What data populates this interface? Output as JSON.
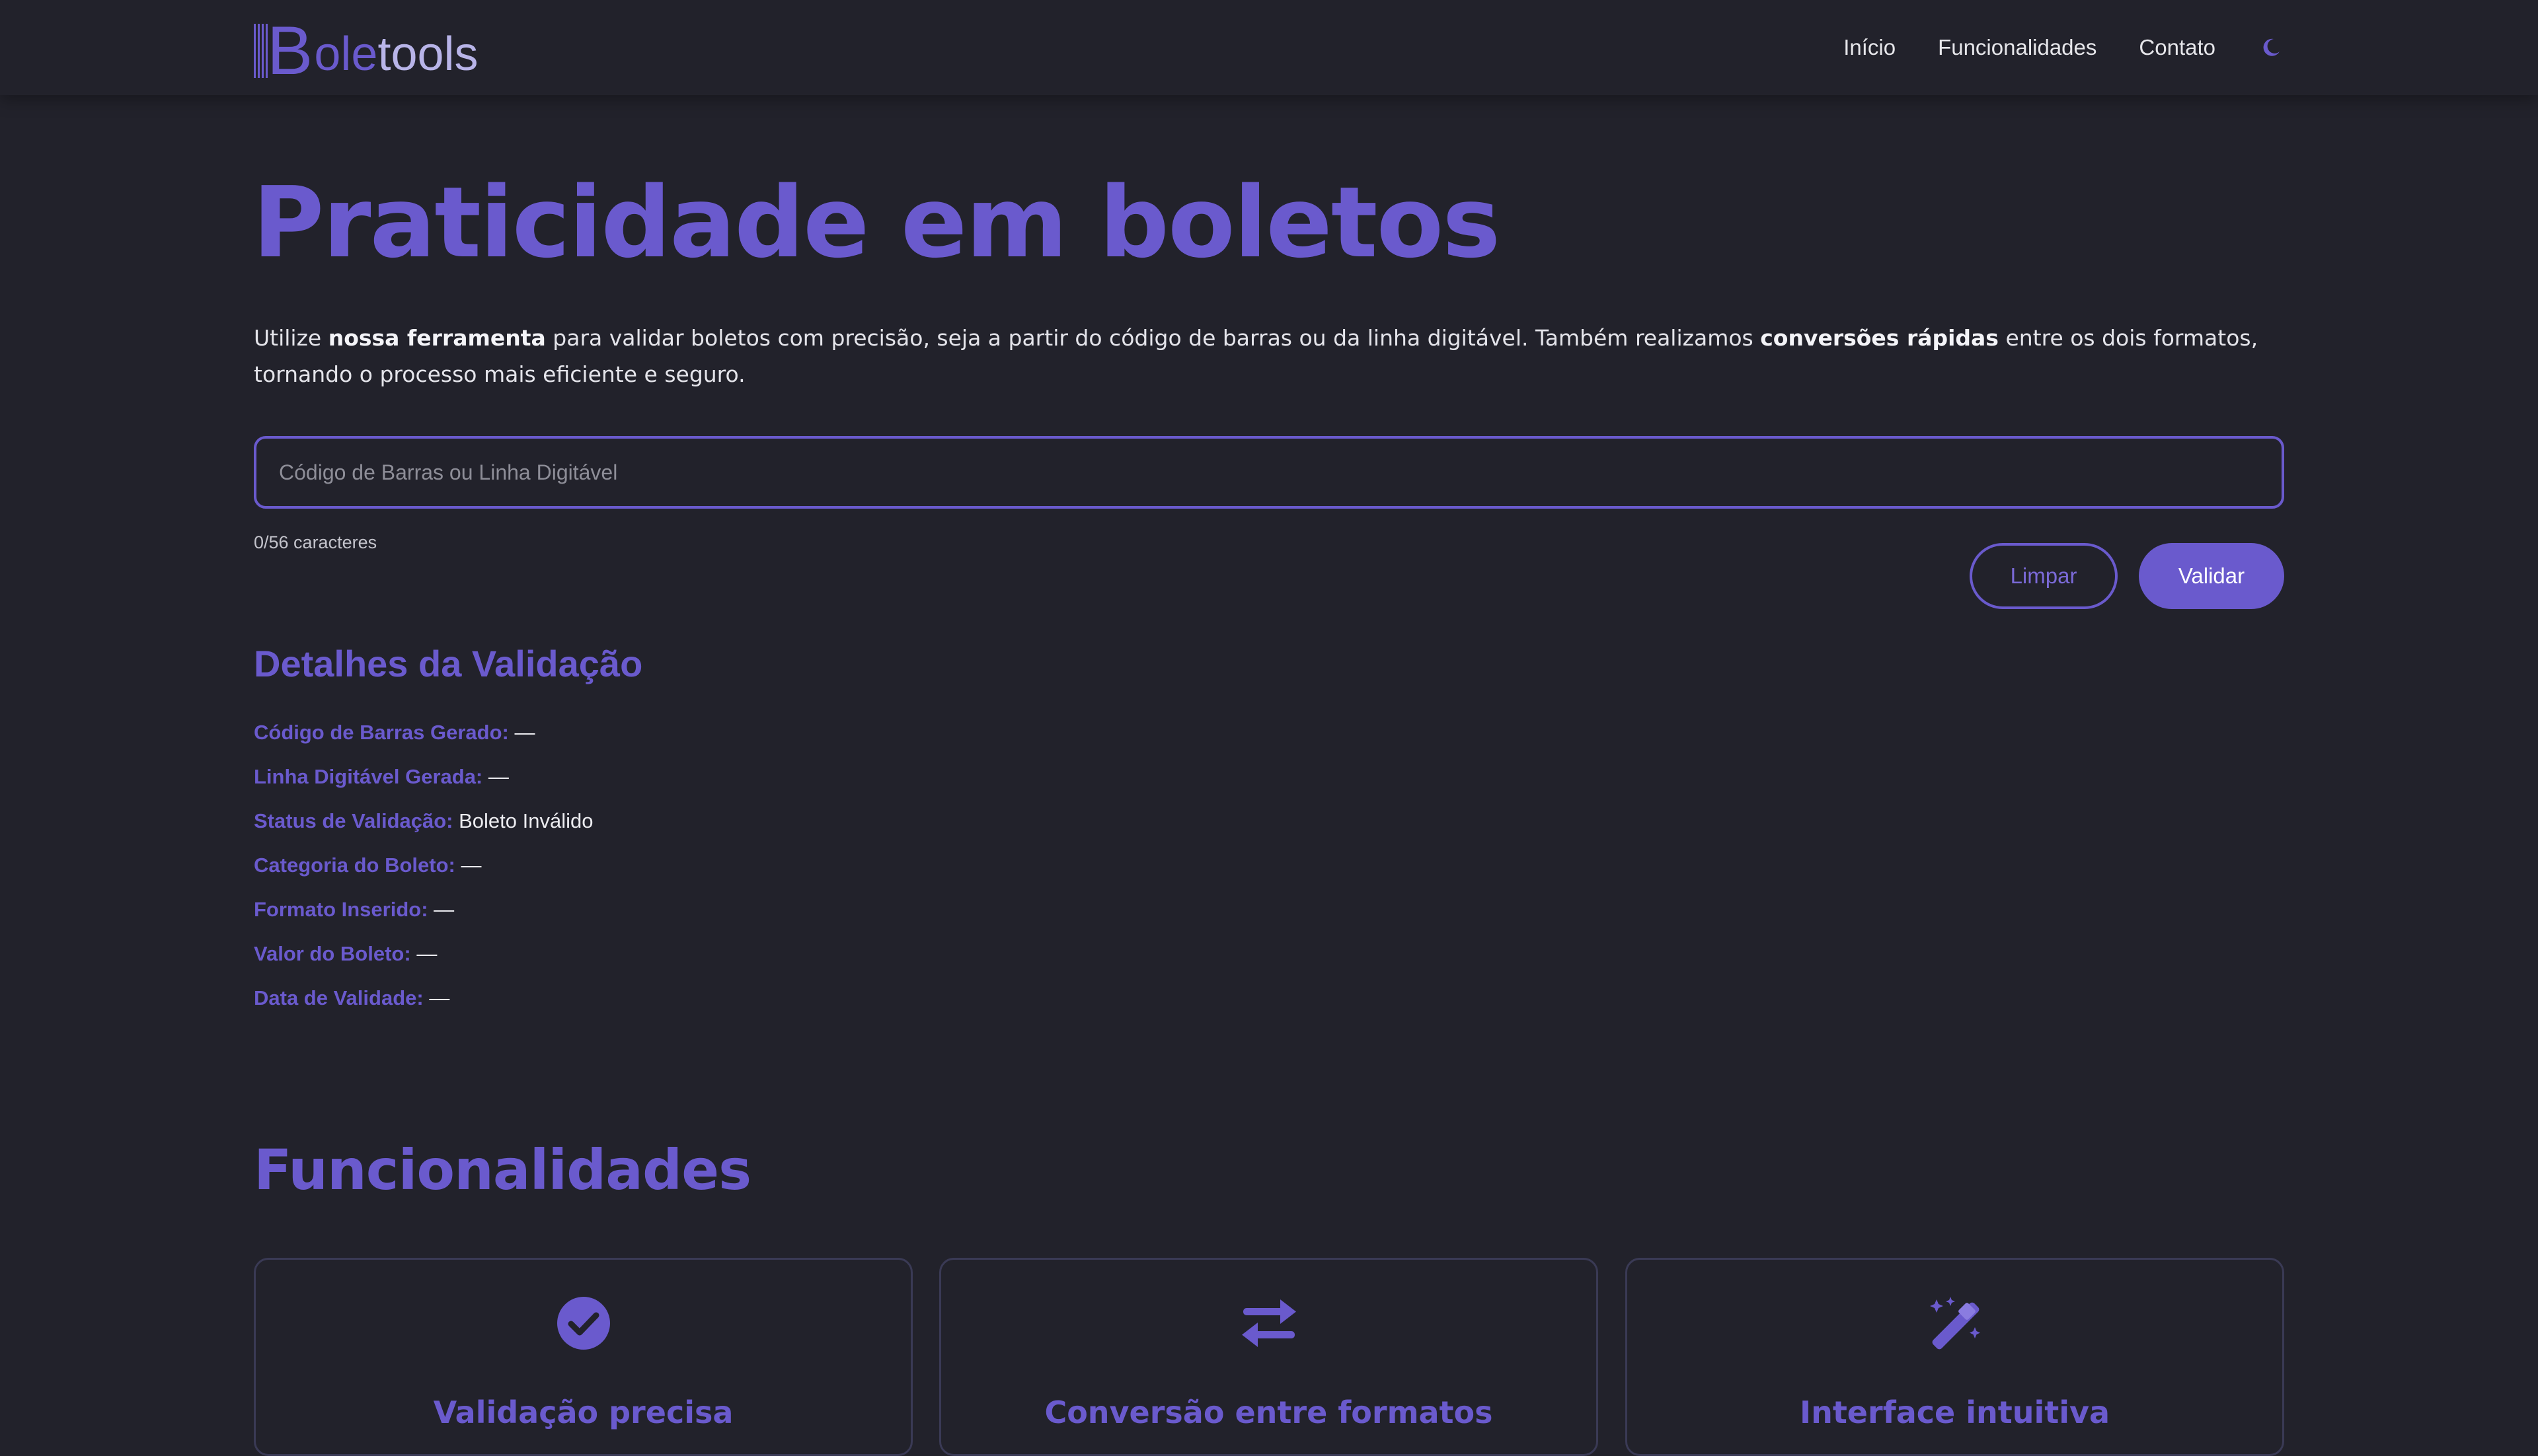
{
  "brand": {
    "logo_letter": "B",
    "logo_part1": "ole",
    "logo_part2": "tools"
  },
  "nav": {
    "items": [
      {
        "label": "Início"
      },
      {
        "label": "Funcionalidades"
      },
      {
        "label": "Contato"
      }
    ],
    "theme_toggle_icon": "moon-icon"
  },
  "hero": {
    "title": "Praticidade em boletos",
    "desc_1": "Utilize ",
    "desc_bold_1": "nossa ferramenta",
    "desc_2": " para validar boletos com precisão, seja a partir do código de barras ou da linha digitável. Também realizamos ",
    "desc_bold_2": "conversões rápidas",
    "desc_3": " entre os dois formatos, tornando o processo mais eficiente e seguro."
  },
  "input": {
    "value": "",
    "placeholder": "Código de Barras ou Linha Digitável",
    "char_count": "0/56 caracteres"
  },
  "buttons": {
    "clear": "Limpar",
    "validate": "Validar"
  },
  "details": {
    "title": "Detalhes da Validação",
    "rows": [
      {
        "label": "Código de Barras Gerado:",
        "value": "—"
      },
      {
        "label": "Linha Digitável Gerada:",
        "value": "—"
      },
      {
        "label": "Status de Validação:",
        "value": "Boleto Inválido"
      },
      {
        "label": "Categoria do Boleto:",
        "value": "—"
      },
      {
        "label": "Formato Inserido:",
        "value": "—"
      },
      {
        "label": "Valor do Boleto:",
        "value": "—"
      },
      {
        "label": "Data de Validade:",
        "value": "—"
      }
    ]
  },
  "features": {
    "title": "Funcionalidades",
    "cards": [
      {
        "icon": "check-circle-icon",
        "title": "Validação precisa"
      },
      {
        "icon": "exchange-arrows-icon",
        "title": "Conversão entre formatos"
      },
      {
        "icon": "magic-wand-icon",
        "title": "Interface intuitiva"
      }
    ]
  },
  "colors": {
    "background": "#22222b",
    "accent": "#6a5acd",
    "text": "#e6e6ea",
    "card_border": "#3a3a55"
  }
}
